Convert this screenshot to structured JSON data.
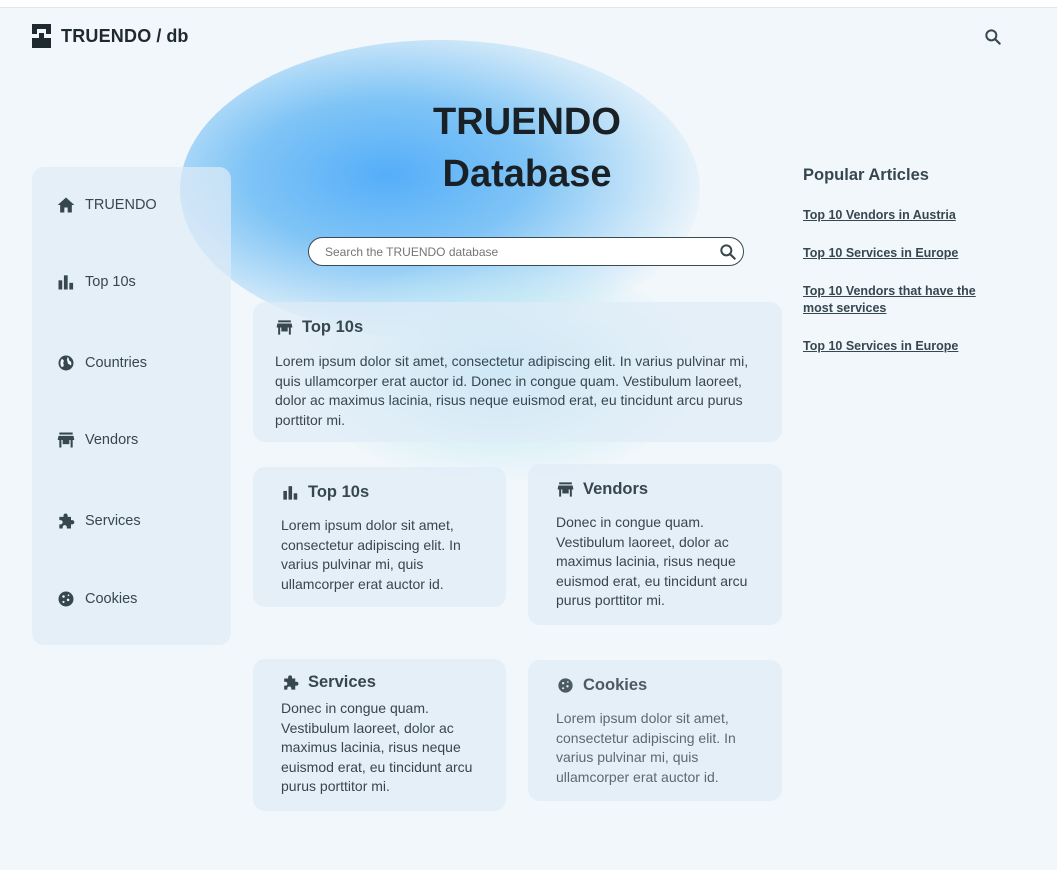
{
  "header": {
    "brand": "TRUENDO",
    "brand_suffix": "/ db",
    "search_icon": "search-icon"
  },
  "hero": {
    "title_line1": "TRUENDO",
    "title_line2": "Database",
    "search_placeholder": "Search the TRUENDO database"
  },
  "sidebar": {
    "items": [
      {
        "label": "TRUENDO",
        "icon": "home-icon"
      },
      {
        "label": "Top 10s",
        "icon": "bar-chart-icon"
      },
      {
        "label": "Countries",
        "icon": "globe-icon"
      },
      {
        "label": "Vendors",
        "icon": "store-icon"
      },
      {
        "label": "Services",
        "icon": "puzzle-icon"
      },
      {
        "label": "Cookies",
        "icon": "cookie-icon"
      }
    ]
  },
  "cards": {
    "featured": {
      "title": "Top 10s",
      "icon": "store-icon",
      "body": "Lorem ipsum dolor sit amet, consectetur adipiscing elit. In varius pulvinar mi, quis ullamcorper erat auctor id. Donec in congue quam. Vestibulum laoreet, dolor ac maximus lacinia, risus neque euismod erat, eu tincidunt arcu purus porttitor mi."
    },
    "top10s": {
      "title": "Top 10s",
      "icon": "bar-chart-icon",
      "body": "Lorem ipsum dolor sit amet, consectetur adipiscing elit. In varius pulvinar mi, quis ullamcorper erat auctor id."
    },
    "vendors": {
      "title": "Vendors",
      "icon": "store-icon",
      "body": "Donec in congue quam. Vestibulum laoreet, dolor ac maximus lacinia, risus neque euismod erat, eu tincidunt arcu purus porttitor mi."
    },
    "services": {
      "title": "Services",
      "icon": "puzzle-icon",
      "body": "Donec in congue quam. Vestibulum laoreet, dolor ac maximus lacinia, risus neque euismod erat, eu tincidunt arcu purus porttitor mi."
    },
    "cookies": {
      "title": "Cookies",
      "icon": "cookie-icon",
      "body": "Lorem ipsum dolor sit amet, consectetur adipiscing elit. In varius pulvinar mi, quis ullamcorper erat auctor id."
    }
  },
  "popular": {
    "heading": "Popular Articles",
    "links": [
      "Top 10 Vendors in Austria",
      "Top 10 Services in Europe",
      "Top 10 Vendors that have the most services",
      "Top 10 Services in Europe"
    ]
  },
  "colors": {
    "background": "#f2f7fb",
    "text": "#37474f",
    "accent_glow": "#55aef9",
    "card": "#dfecf7"
  }
}
